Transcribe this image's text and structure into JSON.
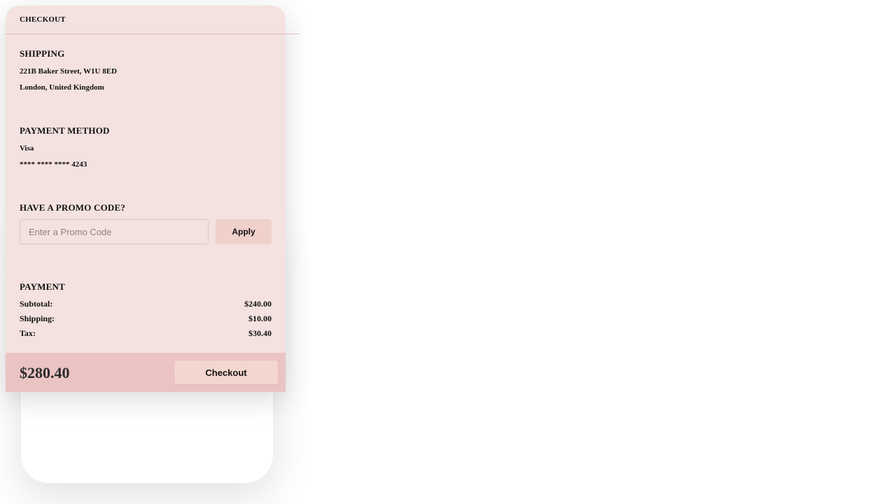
{
  "header": {
    "title": "CHECKOUT"
  },
  "shipping": {
    "title": "SHIPPING",
    "address_line1": "221B Baker Street, W1U 8ED",
    "address_line2": "London, United Kingdom"
  },
  "payment_method": {
    "title": "PAYMENT METHOD",
    "card_type": "Visa",
    "card_number": "**** **** **** 4243"
  },
  "promo": {
    "title": "HAVE A PROMO CODE?",
    "input_value": "",
    "input_placeholder": "Enter a Promo Code",
    "apply_label": "Apply"
  },
  "payment": {
    "title": "PAYMENT",
    "rows": [
      {
        "label": "Subtotal:",
        "value": "$240.00"
      },
      {
        "label": "Shipping:",
        "value": "$10.00"
      },
      {
        "label": "Tax:",
        "value": "$30.40"
      }
    ]
  },
  "footer": {
    "total": "$280.40",
    "checkout_label": "Checkout"
  },
  "colors": {
    "card_background": "#f3e2e0",
    "footer_background": "#eac4c3",
    "button_background": "#f0d0ca",
    "divider": "#e2b9bb"
  }
}
